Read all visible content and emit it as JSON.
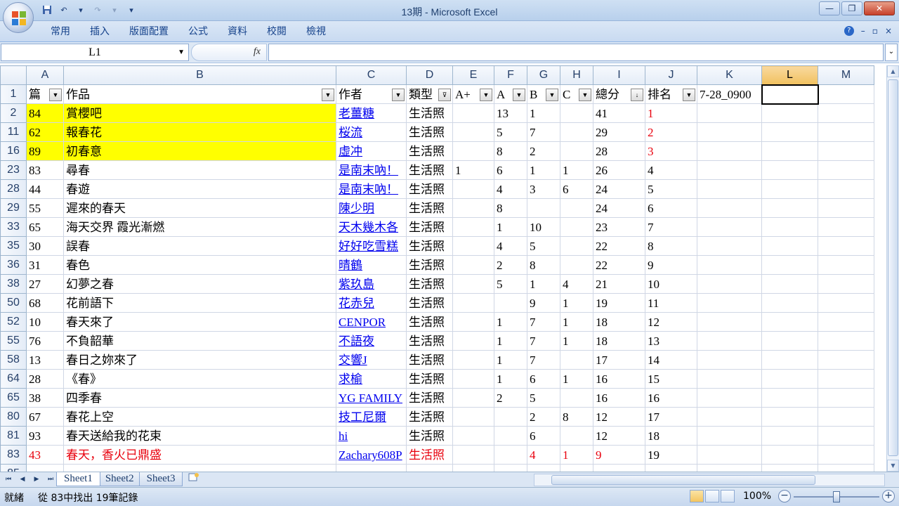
{
  "window": {
    "title": "13期 - Microsoft Excel"
  },
  "ribbon": {
    "tabs": [
      "常用",
      "插入",
      "版面配置",
      "公式",
      "資料",
      "校閱",
      "檢視"
    ]
  },
  "formula_bar": {
    "name_box": "L1",
    "fx_label": "fx",
    "formula": ""
  },
  "columns": [
    "A",
    "B",
    "C",
    "D",
    "E",
    "F",
    "G",
    "H",
    "I",
    "J",
    "K",
    "L",
    "M"
  ],
  "selected_column": "L",
  "header_row": {
    "row_num": "1",
    "cells": [
      "篇",
      "作品",
      "作者",
      "類型",
      "A+",
      "A",
      "B",
      "C",
      "總分",
      "排名",
      "7-28_0900",
      "",
      ""
    ]
  },
  "rows": [
    {
      "num": "2",
      "cells": [
        "84",
        "賞櫻吧",
        "老薑糖",
        "生活照",
        "",
        "13",
        "1",
        "",
        "41",
        "1",
        "",
        "",
        ""
      ],
      "style": "yellow"
    },
    {
      "num": "11",
      "cells": [
        "62",
        "報春花",
        "桜流",
        "生活照",
        "",
        "5",
        "7",
        "",
        "29",
        "2",
        "",
        "",
        ""
      ],
      "style": "yellow"
    },
    {
      "num": "16",
      "cells": [
        "89",
        "初春意",
        "虛冲",
        "生活照",
        "",
        "8",
        "2",
        "",
        "28",
        "3",
        "",
        "",
        ""
      ],
      "style": "yellow"
    },
    {
      "num": "23",
      "cells": [
        "83",
        "尋春",
        "是南末吶！",
        "生活照",
        "1",
        "6",
        "1",
        "1",
        "26",
        "4",
        "",
        "",
        ""
      ],
      "style": ""
    },
    {
      "num": "28",
      "cells": [
        "44",
        "春遊",
        "是南末吶！",
        "生活照",
        "",
        "4",
        "3",
        "6",
        "24",
        "5",
        "",
        "",
        ""
      ],
      "style": ""
    },
    {
      "num": "29",
      "cells": [
        "55",
        "遲來的春天",
        "陳少明",
        "生活照",
        "",
        "8",
        "",
        "",
        "24",
        "6",
        "",
        "",
        ""
      ],
      "style": ""
    },
    {
      "num": "33",
      "cells": [
        "65",
        "海天交界 霞光漸燃",
        "天木幾木各",
        "生活照",
        "",
        "1",
        "10",
        "",
        "23",
        "7",
        "",
        "",
        ""
      ],
      "style": ""
    },
    {
      "num": "35",
      "cells": [
        "30",
        "誤春",
        "好好吃雪糕",
        "生活照",
        "",
        "4",
        "5",
        "",
        "22",
        "8",
        "",
        "",
        ""
      ],
      "style": ""
    },
    {
      "num": "36",
      "cells": [
        "31",
        "春色",
        "晴鶴",
        "生活照",
        "",
        "2",
        "8",
        "",
        "22",
        "9",
        "",
        "",
        ""
      ],
      "style": ""
    },
    {
      "num": "38",
      "cells": [
        "27",
        "幻夢之春",
        "紫玖島",
        "生活照",
        "",
        "5",
        "1",
        "4",
        "21",
        "10",
        "",
        "",
        ""
      ],
      "style": ""
    },
    {
      "num": "50",
      "cells": [
        "68",
        "花前語下",
        "花赤兒",
        "生活照",
        "",
        "",
        "9",
        "1",
        "19",
        "11",
        "",
        "",
        ""
      ],
      "style": ""
    },
    {
      "num": "52",
      "cells": [
        "10",
        "春天來了",
        "CENPOR",
        "生活照",
        "",
        "1",
        "7",
        "1",
        "18",
        "12",
        "",
        "",
        ""
      ],
      "style": ""
    },
    {
      "num": "55",
      "cells": [
        "76",
        "不負韶華",
        "不語夜",
        "生活照",
        "",
        "1",
        "7",
        "1",
        "18",
        "13",
        "",
        "",
        ""
      ],
      "style": ""
    },
    {
      "num": "58",
      "cells": [
        "13",
        "春日之妳來了",
        "交響J",
        "生活照",
        "",
        "1",
        "7",
        "",
        "17",
        "14",
        "",
        "",
        ""
      ],
      "style": ""
    },
    {
      "num": "64",
      "cells": [
        "28",
        "《春》",
        "求榆",
        "生活照",
        "",
        "1",
        "6",
        "1",
        "16",
        "15",
        "",
        "",
        ""
      ],
      "style": ""
    },
    {
      "num": "65",
      "cells": [
        "38",
        "四季春",
        "YG FAMILY",
        "生活照",
        "",
        "2",
        "5",
        "",
        "16",
        "16",
        "",
        "",
        ""
      ],
      "style": ""
    },
    {
      "num": "80",
      "cells": [
        "67",
        "春花上空",
        "技工尼爾",
        "生活照",
        "",
        "",
        "2",
        "8",
        "12",
        "17",
        "",
        "",
        ""
      ],
      "style": ""
    },
    {
      "num": "81",
      "cells": [
        "93",
        "春天送給我的花束",
        "hi",
        "生活照",
        "",
        "",
        "6",
        "",
        "12",
        "18",
        "",
        "",
        ""
      ],
      "style": ""
    },
    {
      "num": "83",
      "cells": [
        "43",
        "春天，香火已鼎盛",
        "Zachary608P",
        "生活照",
        "",
        "",
        "4",
        "1",
        "9",
        "19",
        "",
        "",
        ""
      ],
      "style": "red"
    },
    {
      "num": "85",
      "cells": [
        "",
        "",
        "",
        "",
        "",
        "",
        "",
        "",
        "",
        "",
        "",
        "",
        ""
      ],
      "style": ""
    }
  ],
  "sheets": [
    "Sheet1",
    "Sheet2",
    "Sheet3"
  ],
  "active_sheet": "Sheet1",
  "status": {
    "ready": "就緒",
    "message": "從 83中找出 19筆記錄",
    "zoom": "100%"
  }
}
